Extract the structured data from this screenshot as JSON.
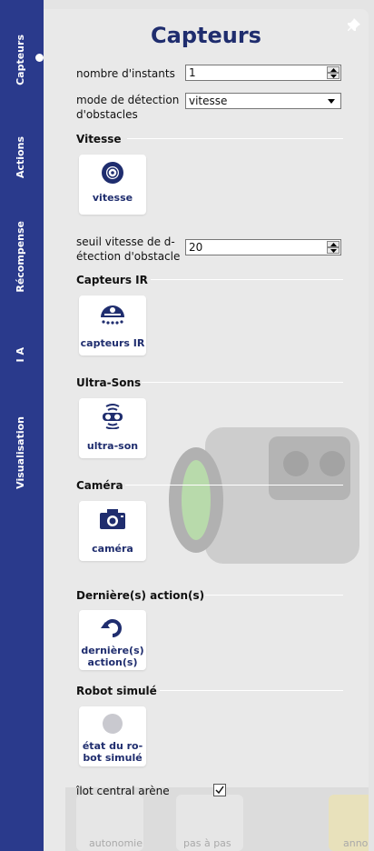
{
  "sidebar": {
    "tabs": [
      {
        "label": "Capteurs",
        "active": true
      },
      {
        "label": "Actions",
        "active": false
      },
      {
        "label": "Récompense",
        "active": false
      },
      {
        "label": "I A",
        "active": false
      },
      {
        "label": "Visualisation",
        "active": false
      }
    ]
  },
  "panel": {
    "title": "Capteurs",
    "fields": {
      "nombre_instants": {
        "label": "nombre d'instants",
        "value": "1"
      },
      "mode_detection": {
        "label": "mode de détection d'obstacles",
        "value": "vitesse"
      },
      "seuil_vitesse": {
        "label": "seuil vitesse de d-étection d'obstacle",
        "value": "20"
      },
      "ilot": {
        "label": "îlot central arène",
        "checked": true
      }
    },
    "sections": {
      "vitesse": {
        "title": "Vitesse",
        "card": "vitesse",
        "icon": "wheel-icon"
      },
      "ir": {
        "title": "Capteurs IR",
        "card": "capteurs IR",
        "icon": "ir-sensor-icon"
      },
      "ultrason": {
        "title": "Ultra-Sons",
        "card": "ultra-son",
        "icon": "ultrasound-icon"
      },
      "camera": {
        "title": "Caméra",
        "card": "caméra",
        "icon": "camera-icon"
      },
      "actions": {
        "title": "Dernière(s) action(s)",
        "card": "dernière(s)\naction(s)",
        "icon": "undo-icon"
      },
      "robot": {
        "title": "Robot simulé",
        "card": "état du ro-\nbot simulé",
        "icon": "circle-icon"
      }
    }
  },
  "bottom_bar": {
    "items": [
      "autonomie",
      "pas à pas",
      "anno"
    ]
  },
  "colors": {
    "sidebar": "#2a3a8c",
    "title": "#1f2d6e",
    "panel": "#e9e9e9"
  }
}
